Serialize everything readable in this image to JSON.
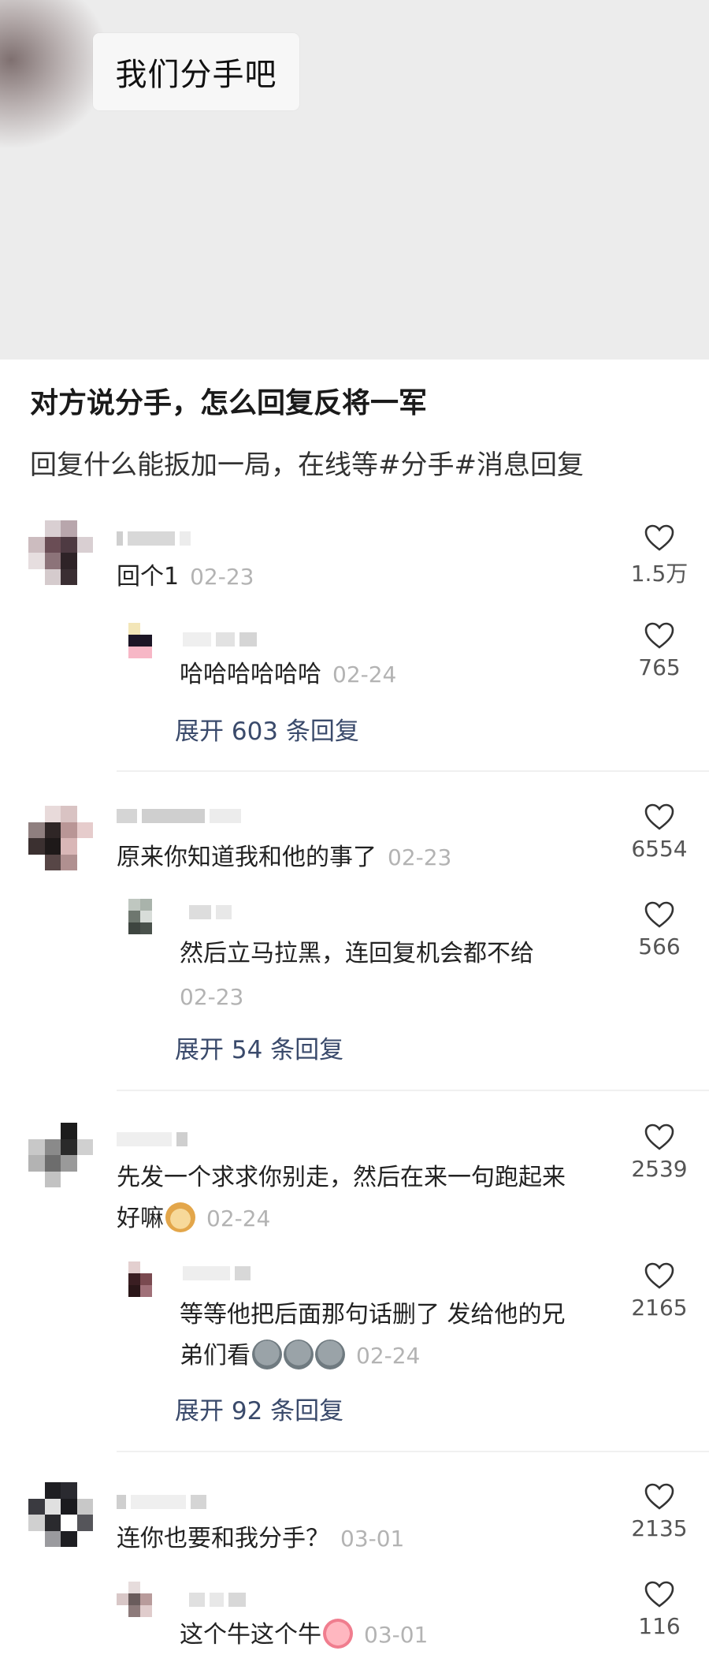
{
  "hero": {
    "bubble_text": "我们分手吧"
  },
  "post": {
    "title": "对方说分手，怎么回复反将一军",
    "description": "回复什么能扳加一局，在线等#分手#消息回复"
  },
  "comments": [
    {
      "text": "回个1",
      "date": "02-23",
      "likes": "1.5万",
      "reply": {
        "text": "哈哈哈哈哈哈",
        "date": "02-24",
        "likes": "765"
      },
      "expand": "展开 603 条回复"
    },
    {
      "text": "原来你知道我和他的事了",
      "date": "02-23",
      "likes": "6554",
      "reply": {
        "text": "然后立马拉黑，连回复机会都不给",
        "date": "02-23",
        "likes": "566"
      },
      "expand": "展开 54 条回复"
    },
    {
      "text_line1": "先发一个求求你别走，然后在来一句跑起来",
      "text_line2": "好嘛",
      "date": "02-24",
      "likes": "2539",
      "reply": {
        "text_line1": "等等他把后面那句话删了 发给他的兄",
        "text_line2": "弟们看",
        "date": "02-24",
        "likes": "2165"
      },
      "expand": "展开 92 条回复"
    },
    {
      "text": "连你也要和我分手？",
      "date": "03-01",
      "likes": "2135",
      "reply": {
        "text": "这个牛这个牛",
        "date": "03-01",
        "likes": "116"
      }
    }
  ],
  "icons": {
    "like": "heart-outline-icon"
  },
  "colors": {
    "expand_link": "#3a4a6b",
    "date": "#b3b3b3"
  }
}
